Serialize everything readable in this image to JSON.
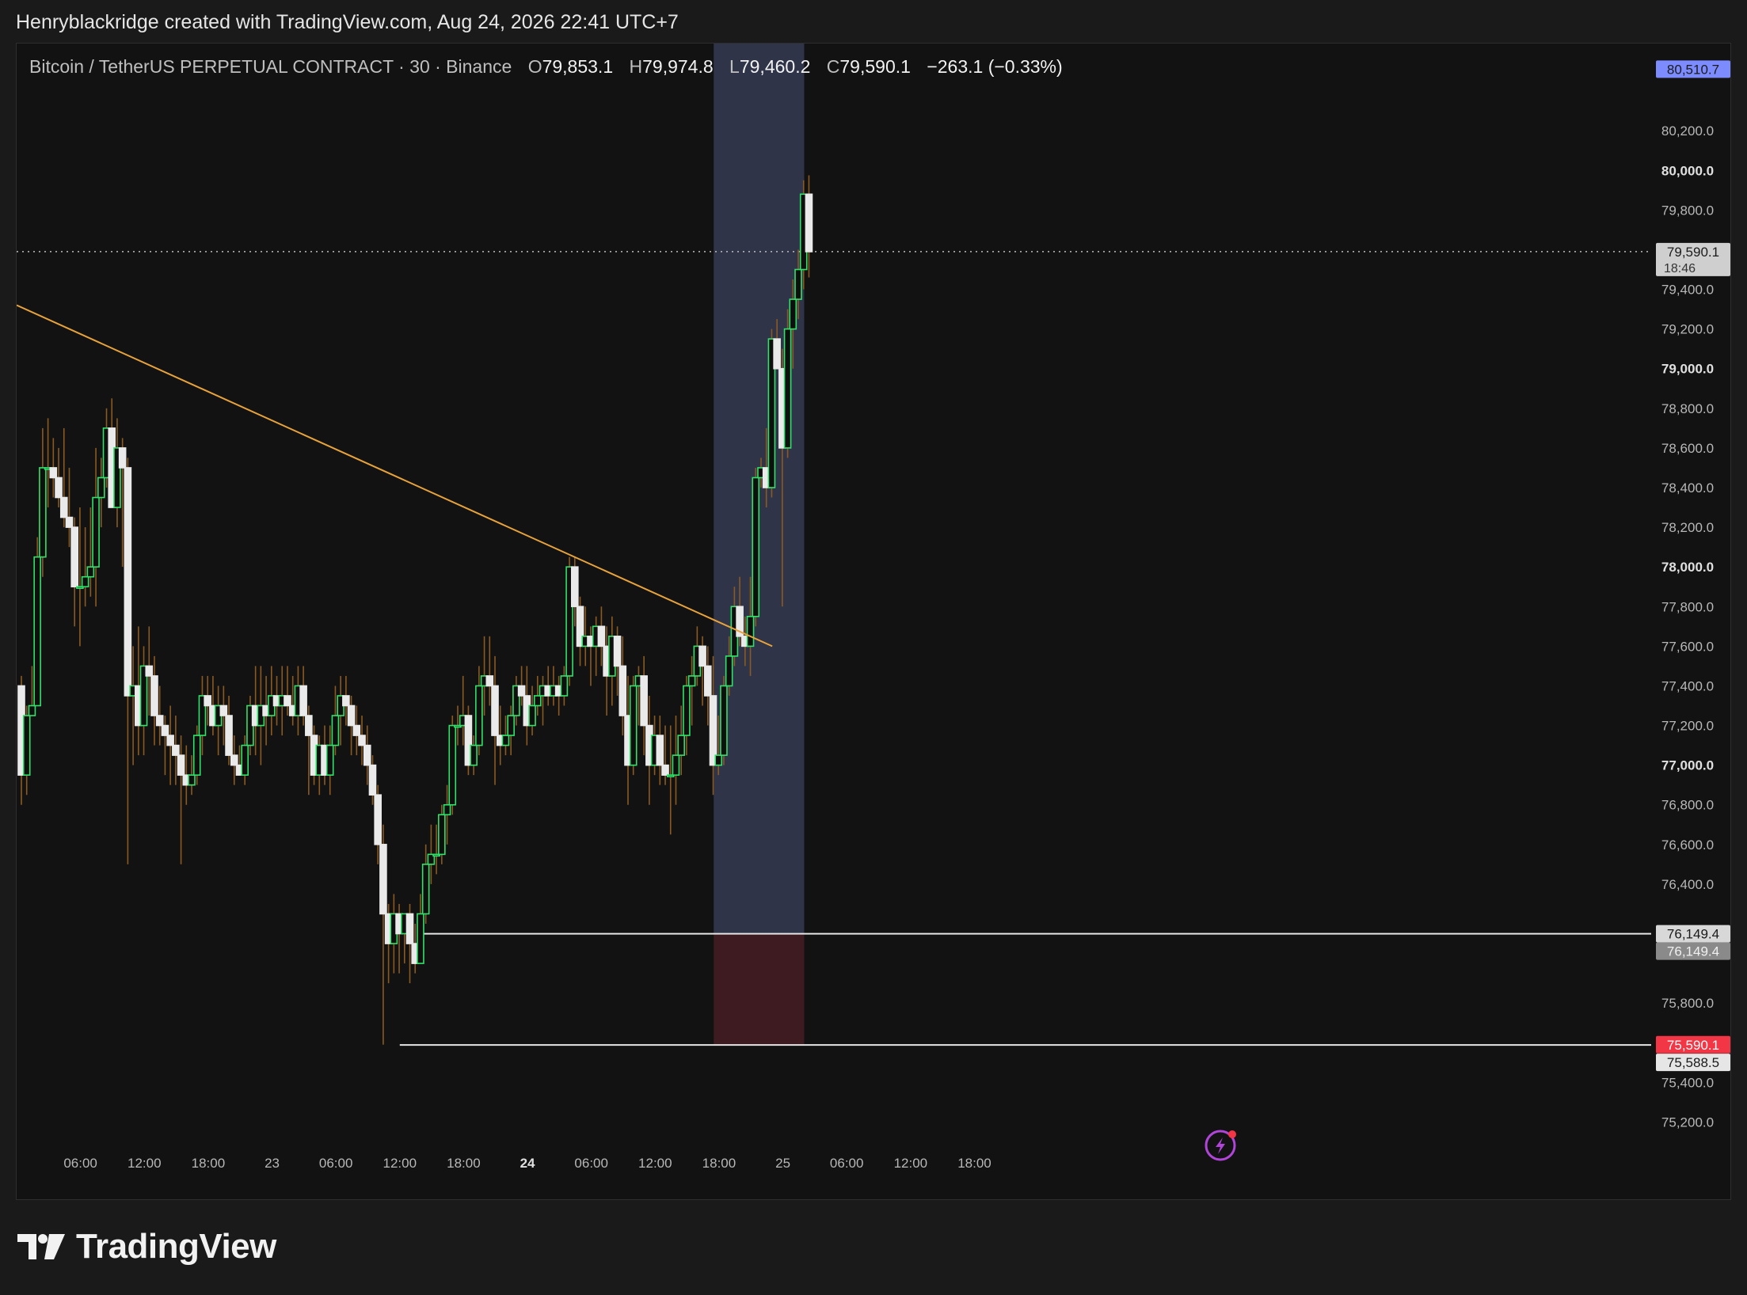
{
  "header": {
    "attribution": "Henryblackridge created with TradingView.com, Aug 24, 2026 22:41 UTC+7"
  },
  "legend": {
    "symbol": "Bitcoin / TetherUS PERPETUAL CONTRACT · 30 · Binance",
    "open_label": "O",
    "open": "79,853.1",
    "high_label": "H",
    "high": "79,974.8",
    "low_label": "L",
    "low": "79,460.2",
    "close_label": "C",
    "close": "79,590.1",
    "change": "−263.1 (−0.33%)"
  },
  "footer": {
    "brand": "TradingView"
  },
  "colors": {
    "background": "#121212",
    "up_candle": "#2fe26a",
    "down_candle": "#eaeaea",
    "wick": "#8a5a22",
    "trendline": "#e8a33a",
    "profit_zone": "#2f3449",
    "loss_zone": "#3d1b20",
    "entry_tag": "#d8d8d8",
    "stop_tag": "#f23645",
    "target_tag": "#7c8cff"
  },
  "chart_data": {
    "type": "candlestick",
    "y_range": [
      75130,
      80560
    ],
    "y_ticks": [
      {
        "value": 75200,
        "label": "75,200.0",
        "bold": false
      },
      {
        "value": 75400,
        "label": "75,400.0",
        "bold": false
      },
      {
        "value": 75800,
        "label": "75,800.0",
        "bold": false
      },
      {
        "value": 76400,
        "label": "76,400.0",
        "bold": false
      },
      {
        "value": 76600,
        "label": "76,600.0",
        "bold": false
      },
      {
        "value": 76800,
        "label": "76,800.0",
        "bold": false
      },
      {
        "value": 77000,
        "label": "77,000.0",
        "bold": true
      },
      {
        "value": 77200,
        "label": "77,200.0",
        "bold": false
      },
      {
        "value": 77400,
        "label": "77,400.0",
        "bold": false
      },
      {
        "value": 77600,
        "label": "77,600.0",
        "bold": false
      },
      {
        "value": 77800,
        "label": "77,800.0",
        "bold": false
      },
      {
        "value": 78000,
        "label": "78,000.0",
        "bold": true
      },
      {
        "value": 78200,
        "label": "78,200.0",
        "bold": false
      },
      {
        "value": 78400,
        "label": "78,400.0",
        "bold": false
      },
      {
        "value": 78600,
        "label": "78,600.0",
        "bold": false
      },
      {
        "value": 78800,
        "label": "78,800.0",
        "bold": false
      },
      {
        "value": 79000,
        "label": "79,000.0",
        "bold": true
      },
      {
        "value": 79200,
        "label": "79,200.0",
        "bold": false
      },
      {
        "value": 79400,
        "label": "79,400.0",
        "bold": false
      },
      {
        "value": 79800,
        "label": "79,800.0",
        "bold": false
      },
      {
        "value": 80000,
        "label": "80,000.0",
        "bold": true
      },
      {
        "value": 80200,
        "label": "80,200.0",
        "bold": false
      }
    ],
    "x_range_hours": [
      0,
      148
    ],
    "x_ticks": [
      {
        "hour": 6,
        "label": "06:00",
        "bold": false
      },
      {
        "hour": 12,
        "label": "12:00",
        "bold": false
      },
      {
        "hour": 18,
        "label": "18:00",
        "bold": false
      },
      {
        "hour": 24,
        "label": "23",
        "bold": false
      },
      {
        "hour": 30,
        "label": "06:00",
        "bold": false
      },
      {
        "hour": 36,
        "label": "12:00",
        "bold": false
      },
      {
        "hour": 42,
        "label": "18:00",
        "bold": false
      },
      {
        "hour": 48,
        "label": "24",
        "bold": true
      },
      {
        "hour": 54,
        "label": "06:00",
        "bold": false
      },
      {
        "hour": 60,
        "label": "12:00",
        "bold": false
      },
      {
        "hour": 66,
        "label": "18:00",
        "bold": false
      },
      {
        "hour": 72,
        "label": "25",
        "bold": false
      },
      {
        "hour": 78,
        "label": "06:00",
        "bold": false
      },
      {
        "hour": 84,
        "label": "12:00",
        "bold": false
      },
      {
        "hour": 90,
        "label": "18:00",
        "bold": false
      }
    ],
    "start_price": 77300,
    "ohlc": [
      [
        77400,
        77450,
        76800,
        76950
      ],
      [
        76950,
        77300,
        76850,
        77250
      ],
      [
        77250,
        77500,
        77250,
        77300
      ],
      [
        77300,
        78150,
        77300,
        78050
      ],
      [
        78050,
        78700,
        77950,
        78500
      ],
      [
        78500,
        78750,
        78300,
        78500
      ],
      [
        78500,
        78650,
        78350,
        78450
      ],
      [
        78450,
        78600,
        78300,
        78350
      ],
      [
        78350,
        78700,
        78200,
        78250
      ],
      [
        78250,
        78500,
        78100,
        78200
      ],
      [
        78200,
        78250,
        77700,
        77900
      ],
      [
        77900,
        78300,
        77600,
        77900
      ],
      [
        77900,
        78200,
        77800,
        77950
      ],
      [
        77950,
        78300,
        77850,
        78000
      ],
      [
        78000,
        78600,
        77800,
        78350
      ],
      [
        78350,
        78550,
        78200,
        78450
      ],
      [
        78450,
        78800,
        78400,
        78700
      ],
      [
        78700,
        78850,
        78400,
        78300
      ],
      [
        78300,
        78750,
        78200,
        78600
      ],
      [
        78600,
        78650,
        78000,
        78500
      ],
      [
        78500,
        78550,
        76500,
        77350
      ],
      [
        77350,
        77600,
        77000,
        77400
      ],
      [
        77400,
        77700,
        77050,
        77200
      ],
      [
        77200,
        77600,
        77050,
        77500
      ],
      [
        77500,
        77700,
        77250,
        77450
      ],
      [
        77450,
        77550,
        77100,
        77250
      ],
      [
        77250,
        77400,
        77100,
        77200
      ],
      [
        77200,
        77250,
        76950,
        77150
      ],
      [
        77150,
        77300,
        76900,
        77100
      ],
      [
        77100,
        77250,
        76900,
        77050
      ],
      [
        77050,
        77150,
        76500,
        76950
      ],
      [
        76950,
        77100,
        76800,
        76900
      ],
      [
        76900,
        77050,
        76850,
        76950
      ],
      [
        76950,
        77200,
        76900,
        77150
      ],
      [
        77150,
        77450,
        77050,
        77350
      ],
      [
        77350,
        77450,
        77200,
        77300
      ],
      [
        77300,
        77450,
        77150,
        77200
      ],
      [
        77200,
        77400,
        77050,
        77300
      ],
      [
        77300,
        77400,
        77100,
        77250
      ],
      [
        77250,
        77350,
        77000,
        77050
      ],
      [
        77050,
        77150,
        76900,
        77000
      ],
      [
        77000,
        77100,
        76950,
        76950
      ],
      [
        76950,
        77150,
        76900,
        77100
      ],
      [
        77100,
        77350,
        77050,
        77300
      ],
      [
        77300,
        77500,
        77050,
        77200
      ],
      [
        77200,
        77500,
        77000,
        77300
      ],
      [
        77300,
        77450,
        77100,
        77250
      ],
      [
        77250,
        77500,
        77150,
        77350
      ],
      [
        77350,
        77450,
        77200,
        77300
      ],
      [
        77300,
        77500,
        77150,
        77350
      ],
      [
        77350,
        77500,
        77250,
        77300
      ],
      [
        77300,
        77450,
        77200,
        77250
      ],
      [
        77250,
        77500,
        77150,
        77400
      ],
      [
        77400,
        77500,
        77200,
        77250
      ],
      [
        77250,
        77300,
        76850,
        77150
      ],
      [
        77150,
        77200,
        76900,
        76950
      ],
      [
        76950,
        77150,
        76850,
        77100
      ],
      [
        77100,
        77200,
        76900,
        76950
      ],
      [
        76950,
        77200,
        76850,
        77100
      ],
      [
        77100,
        77400,
        77050,
        77250
      ],
      [
        77250,
        77450,
        77100,
        77350
      ],
      [
        77350,
        77450,
        77200,
        77300
      ],
      [
        77300,
        77350,
        77050,
        77200
      ],
      [
        77200,
        77300,
        77050,
        77150
      ],
      [
        77150,
        77250,
        77000,
        77100
      ],
      [
        77100,
        77200,
        76900,
        77000
      ],
      [
        77000,
        77050,
        76800,
        76850
      ],
      [
        76850,
        76900,
        76500,
        76600
      ],
      [
        76600,
        76700,
        75590,
        76250
      ],
      [
        76250,
        76300,
        75900,
        76100
      ],
      [
        76100,
        76350,
        75950,
        76250
      ],
      [
        76250,
        76300,
        75950,
        76150
      ],
      [
        76150,
        76250,
        76000,
        76250
      ],
      [
        76250,
        76300,
        75900,
        76100
      ],
      [
        76100,
        76200,
        75950,
        76000
      ],
      [
        76000,
        76350,
        76000,
        76250
      ],
      [
        76250,
        76600,
        76200,
        76500
      ],
      [
        76500,
        76700,
        76400,
        76550
      ],
      [
        76550,
        76700,
        76450,
        76550
      ],
      [
        76550,
        76800,
        76500,
        76750
      ],
      [
        76750,
        76900,
        76600,
        76800
      ],
      [
        76800,
        77250,
        76750,
        77200
      ],
      [
        77200,
        77300,
        77100,
        77200
      ],
      [
        77200,
        77450,
        77100,
        77250
      ],
      [
        77250,
        77300,
        76950,
        77000
      ],
      [
        77000,
        77150,
        76950,
        77100
      ],
      [
        77100,
        77500,
        77050,
        77400
      ],
      [
        77400,
        77650,
        77250,
        77450
      ],
      [
        77450,
        77650,
        77300,
        77400
      ],
      [
        77400,
        77550,
        76900,
        77150
      ],
      [
        77150,
        77300,
        77000,
        77100
      ],
      [
        77100,
        77250,
        77050,
        77150
      ],
      [
        77150,
        77300,
        77050,
        77250
      ],
      [
        77250,
        77450,
        77200,
        77400
      ],
      [
        77400,
        77500,
        77300,
        77350
      ],
      [
        77350,
        77500,
        77100,
        77200
      ],
      [
        77200,
        77400,
        77150,
        77300
      ],
      [
        77300,
        77450,
        77250,
        77350
      ],
      [
        77350,
        77450,
        77200,
        77400
      ],
      [
        77400,
        77500,
        77300,
        77350
      ],
      [
        77350,
        77500,
        77300,
        77400
      ],
      [
        77400,
        77450,
        77250,
        77350
      ],
      [
        77350,
        77500,
        77300,
        77450
      ],
      [
        77450,
        78050,
        77400,
        78000
      ],
      [
        78000,
        78050,
        77700,
        77800
      ],
      [
        77800,
        77850,
        77500,
        77600
      ],
      [
        77600,
        77800,
        77500,
        77650
      ],
      [
        77650,
        77700,
        77400,
        77600
      ],
      [
        77600,
        77750,
        77450,
        77700
      ],
      [
        77700,
        77800,
        77500,
        77600
      ],
      [
        77600,
        77700,
        77250,
        77450
      ],
      [
        77450,
        77750,
        77300,
        77650
      ],
      [
        77650,
        77700,
        77350,
        77500
      ],
      [
        77500,
        77650,
        77150,
        77250
      ],
      [
        77250,
        77450,
        76800,
        77000
      ],
      [
        77000,
        77450,
        76950,
        77400
      ],
      [
        77400,
        77500,
        77200,
        77450
      ],
      [
        77450,
        77550,
        77050,
        77200
      ],
      [
        77200,
        77350,
        76800,
        77000
      ],
      [
        77000,
        77250,
        76950,
        77150
      ],
      [
        77150,
        77250,
        76900,
        77000
      ],
      [
        77000,
        77200,
        76900,
        76950
      ],
      [
        76950,
        77200,
        76650,
        76950
      ],
      [
        76950,
        77250,
        76800,
        77050
      ],
      [
        77050,
        77300,
        76950,
        77150
      ],
      [
        77150,
        77450,
        77050,
        77400
      ],
      [
        77400,
        77550,
        77200,
        77450
      ],
      [
        77450,
        77700,
        77400,
        77600
      ],
      [
        77600,
        77650,
        77300,
        77500
      ],
      [
        77500,
        77600,
        77200,
        77350
      ],
      [
        77350,
        77550,
        76850,
        77000
      ],
      [
        77000,
        77250,
        76950,
        77050
      ],
      [
        77050,
        77450,
        77000,
        77400
      ],
      [
        77400,
        77650,
        77350,
        77550
      ],
      [
        77550,
        77900,
        77500,
        77800
      ],
      [
        77800,
        77950,
        77600,
        77650
      ],
      [
        77650,
        77750,
        77500,
        77600
      ],
      [
        77600,
        77950,
        77450,
        77750
      ],
      [
        77750,
        78500,
        77700,
        78450
      ],
      [
        78450,
        78550,
        78400,
        78500
      ],
      [
        78500,
        78700,
        78300,
        78400
      ],
      [
        78400,
        79200,
        78350,
        79150
      ],
      [
        79150,
        79250,
        79000,
        79000
      ],
      [
        79000,
        79100,
        77800,
        78600
      ],
      [
        78600,
        79300,
        78550,
        79200
      ],
      [
        79200,
        79450,
        79000,
        79350
      ],
      [
        79350,
        79600,
        79250,
        79500
      ],
      [
        79500,
        79950,
        79400,
        79880
      ],
      [
        79880,
        79975,
        79460,
        79590
      ]
    ],
    "trendline": {
      "start": {
        "hour": 0,
        "price": 79320
      },
      "end": {
        "hour": 71,
        "price": 77600
      }
    },
    "horizontal_lines": [
      {
        "price": 76149.4,
        "from_hour": 38,
        "to_hour": 148
      },
      {
        "price": 75588.5,
        "from_hour": 36,
        "to_hour": 148
      }
    ],
    "position": {
      "type": "long",
      "from_hour": 65.5,
      "to_hour": 74,
      "entry": 76149.4,
      "target": 80510.7,
      "stop": 75590.1
    },
    "last_price": {
      "price": 79590.1,
      "label": "79,590.1",
      "countdown": "18:46"
    },
    "price_tags": [
      {
        "price": 80510.7,
        "label": "80,510.7",
        "style": "target"
      },
      {
        "price": 76149.4,
        "label": "76,149.4",
        "style": "entry"
      },
      {
        "price": 76149.4,
        "label": "76,149.4",
        "style": "entry-dark",
        "offset": 1
      },
      {
        "price": 75590.1,
        "label": "75,590.1",
        "style": "stop"
      },
      {
        "price": 75588.5,
        "label": "75,588.5",
        "style": "plain",
        "offset": 1
      }
    ]
  }
}
